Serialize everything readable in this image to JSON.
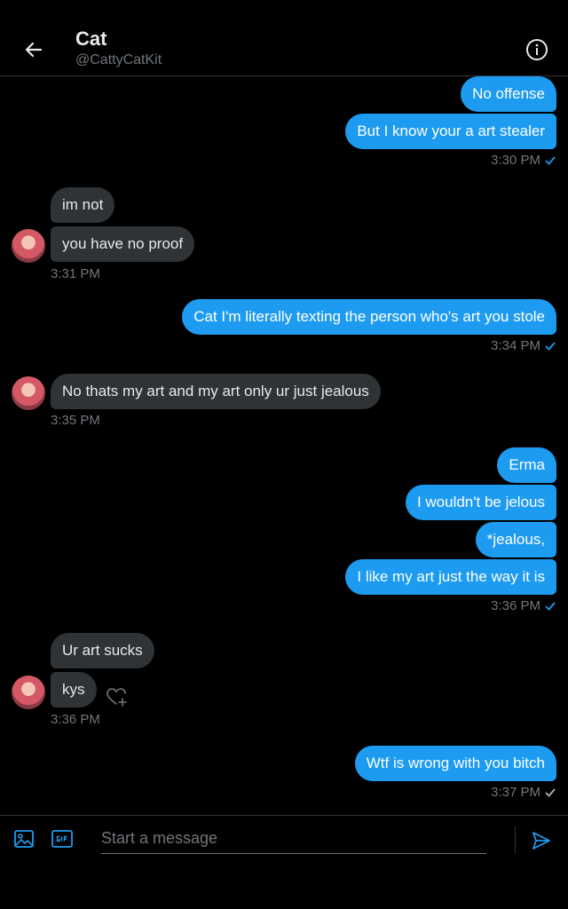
{
  "header": {
    "title": "Cat",
    "handle": "@CattyCatKit"
  },
  "messages": {
    "m1": "No offense",
    "m2": "But I know your a art stealer",
    "t1": "3:30 PM",
    "m3": "im not",
    "m4": "you have no proof",
    "t2": "3:31 PM",
    "m5": "Cat I'm literally texting the person who's art you stole",
    "t3": "3:34 PM",
    "m6": "No thats my art and my art only ur just jealous",
    "t4": "3:35 PM",
    "m7": "Erma",
    "m8": "I wouldn't be jelous",
    "m9": "*jealous,",
    "m10": "I like my art just the way it is",
    "t5": "3:36 PM",
    "m11": "Ur art sucks",
    "m12": "kys",
    "t6": "3:36 PM",
    "m13": "Wtf is wrong with you bitch",
    "t7": "3:37 PM"
  },
  "composer": {
    "placeholder": "Start a message"
  },
  "icons": {
    "back": "arrow-left-icon",
    "info": "info-icon",
    "media": "image-icon",
    "gif": "gif-icon",
    "send": "send-icon",
    "react": "heart-plus-icon",
    "read_receipt": "check-icon"
  },
  "colors": {
    "accent": "#1d9bf0",
    "received_bubble": "#2f3336",
    "background": "#000000",
    "muted_text": "#71767b"
  }
}
